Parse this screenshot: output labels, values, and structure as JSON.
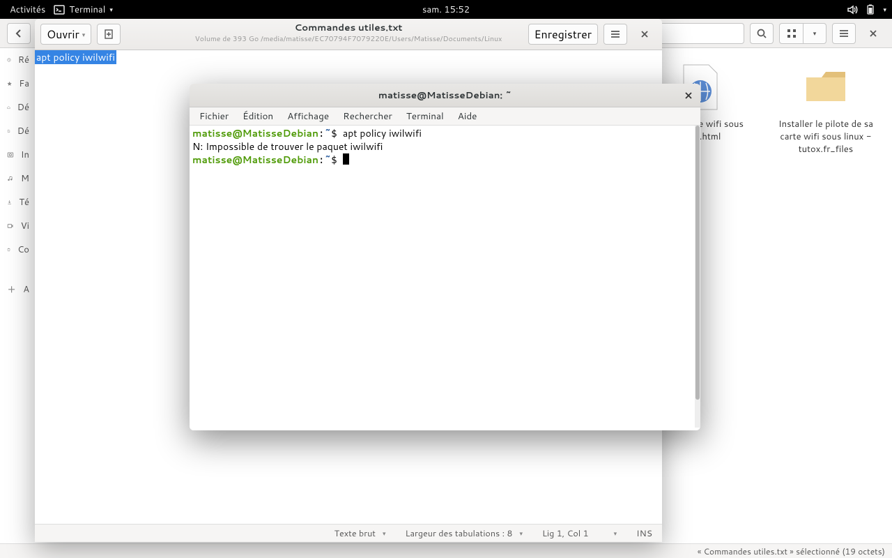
{
  "topbar": {
    "activities": "Activités",
    "app": "Terminal",
    "clock": "sam. 15:52"
  },
  "fm": {
    "path": "/",
    "drive": "",
    "search_placeholder": "",
    "sidebar": [
      "Ré",
      "Fa",
      "Dé",
      "Dé",
      "In",
      "M",
      "Té",
      "Vi",
      "Co",
      "A"
    ],
    "files": [
      {
        "label": "le pilote de wifi sous ox.fr.html"
      },
      {
        "label": "Installer le pilote de sa carte wifi sous linux - tutox.fr_files"
      }
    ],
    "status": "« Commandes utiles.txt » sélectionné  (19 octets)"
  },
  "gedit": {
    "open": "Ouvrir",
    "save": "Enregistrer",
    "title": "Commandes utiles.txt",
    "subtitle": "Volume de 393 Go /media/matisse/EC70794F7079220E/Users/Matisse/Documents/Linux",
    "content": "apt policy iwilwifi",
    "status": {
      "syntax": "Texte brut",
      "tabs": "Largeur des tabulations : 8",
      "pos": "Lig 1, Col 1",
      "ins": "INS"
    }
  },
  "term": {
    "title": "matisse@MatisseDebian: ~",
    "menu": [
      "Fichier",
      "Édition",
      "Affichage",
      "Rechercher",
      "Terminal",
      "Aide"
    ],
    "prompt_user": "matisse@MatisseDebian",
    "prompt_path": "~",
    "cmd1": "apt policy iwilwifi",
    "out1": "N: Impossible de trouver le paquet iwilwifi"
  }
}
